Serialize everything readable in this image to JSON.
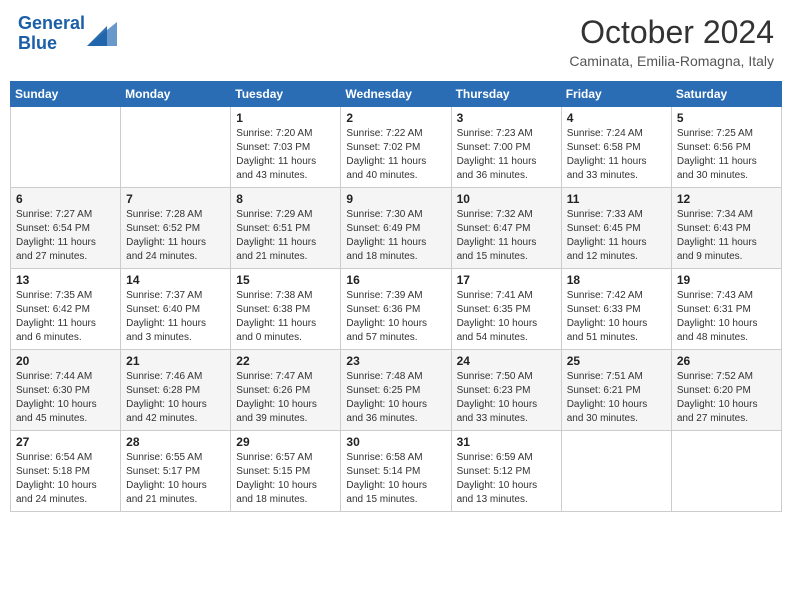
{
  "header": {
    "logo_line1": "General",
    "logo_line2": "Blue",
    "month": "October 2024",
    "location": "Caminata, Emilia-Romagna, Italy"
  },
  "weekdays": [
    "Sunday",
    "Monday",
    "Tuesday",
    "Wednesday",
    "Thursday",
    "Friday",
    "Saturday"
  ],
  "weeks": [
    [
      {
        "day": "",
        "sunrise": "",
        "sunset": "",
        "daylight": ""
      },
      {
        "day": "",
        "sunrise": "",
        "sunset": "",
        "daylight": ""
      },
      {
        "day": "1",
        "sunrise": "7:20 AM",
        "sunset": "7:03 PM",
        "daylight": "11 hours and 43 minutes."
      },
      {
        "day": "2",
        "sunrise": "7:22 AM",
        "sunset": "7:02 PM",
        "daylight": "11 hours and 40 minutes."
      },
      {
        "day": "3",
        "sunrise": "7:23 AM",
        "sunset": "7:00 PM",
        "daylight": "11 hours and 36 minutes."
      },
      {
        "day": "4",
        "sunrise": "7:24 AM",
        "sunset": "6:58 PM",
        "daylight": "11 hours and 33 minutes."
      },
      {
        "day": "5",
        "sunrise": "7:25 AM",
        "sunset": "6:56 PM",
        "daylight": "11 hours and 30 minutes."
      }
    ],
    [
      {
        "day": "6",
        "sunrise": "7:27 AM",
        "sunset": "6:54 PM",
        "daylight": "11 hours and 27 minutes."
      },
      {
        "day": "7",
        "sunrise": "7:28 AM",
        "sunset": "6:52 PM",
        "daylight": "11 hours and 24 minutes."
      },
      {
        "day": "8",
        "sunrise": "7:29 AM",
        "sunset": "6:51 PM",
        "daylight": "11 hours and 21 minutes."
      },
      {
        "day": "9",
        "sunrise": "7:30 AM",
        "sunset": "6:49 PM",
        "daylight": "11 hours and 18 minutes."
      },
      {
        "day": "10",
        "sunrise": "7:32 AM",
        "sunset": "6:47 PM",
        "daylight": "11 hours and 15 minutes."
      },
      {
        "day": "11",
        "sunrise": "7:33 AM",
        "sunset": "6:45 PM",
        "daylight": "11 hours and 12 minutes."
      },
      {
        "day": "12",
        "sunrise": "7:34 AM",
        "sunset": "6:43 PM",
        "daylight": "11 hours and 9 minutes."
      }
    ],
    [
      {
        "day": "13",
        "sunrise": "7:35 AM",
        "sunset": "6:42 PM",
        "daylight": "11 hours and 6 minutes."
      },
      {
        "day": "14",
        "sunrise": "7:37 AM",
        "sunset": "6:40 PM",
        "daylight": "11 hours and 3 minutes."
      },
      {
        "day": "15",
        "sunrise": "7:38 AM",
        "sunset": "6:38 PM",
        "daylight": "11 hours and 0 minutes."
      },
      {
        "day": "16",
        "sunrise": "7:39 AM",
        "sunset": "6:36 PM",
        "daylight": "10 hours and 57 minutes."
      },
      {
        "day": "17",
        "sunrise": "7:41 AM",
        "sunset": "6:35 PM",
        "daylight": "10 hours and 54 minutes."
      },
      {
        "day": "18",
        "sunrise": "7:42 AM",
        "sunset": "6:33 PM",
        "daylight": "10 hours and 51 minutes."
      },
      {
        "day": "19",
        "sunrise": "7:43 AM",
        "sunset": "6:31 PM",
        "daylight": "10 hours and 48 minutes."
      }
    ],
    [
      {
        "day": "20",
        "sunrise": "7:44 AM",
        "sunset": "6:30 PM",
        "daylight": "10 hours and 45 minutes."
      },
      {
        "day": "21",
        "sunrise": "7:46 AM",
        "sunset": "6:28 PM",
        "daylight": "10 hours and 42 minutes."
      },
      {
        "day": "22",
        "sunrise": "7:47 AM",
        "sunset": "6:26 PM",
        "daylight": "10 hours and 39 minutes."
      },
      {
        "day": "23",
        "sunrise": "7:48 AM",
        "sunset": "6:25 PM",
        "daylight": "10 hours and 36 minutes."
      },
      {
        "day": "24",
        "sunrise": "7:50 AM",
        "sunset": "6:23 PM",
        "daylight": "10 hours and 33 minutes."
      },
      {
        "day": "25",
        "sunrise": "7:51 AM",
        "sunset": "6:21 PM",
        "daylight": "10 hours and 30 minutes."
      },
      {
        "day": "26",
        "sunrise": "7:52 AM",
        "sunset": "6:20 PM",
        "daylight": "10 hours and 27 minutes."
      }
    ],
    [
      {
        "day": "27",
        "sunrise": "6:54 AM",
        "sunset": "5:18 PM",
        "daylight": "10 hours and 24 minutes."
      },
      {
        "day": "28",
        "sunrise": "6:55 AM",
        "sunset": "5:17 PM",
        "daylight": "10 hours and 21 minutes."
      },
      {
        "day": "29",
        "sunrise": "6:57 AM",
        "sunset": "5:15 PM",
        "daylight": "10 hours and 18 minutes."
      },
      {
        "day": "30",
        "sunrise": "6:58 AM",
        "sunset": "5:14 PM",
        "daylight": "10 hours and 15 minutes."
      },
      {
        "day": "31",
        "sunrise": "6:59 AM",
        "sunset": "5:12 PM",
        "daylight": "10 hours and 13 minutes."
      },
      {
        "day": "",
        "sunrise": "",
        "sunset": "",
        "daylight": ""
      },
      {
        "day": "",
        "sunrise": "",
        "sunset": "",
        "daylight": ""
      }
    ]
  ]
}
